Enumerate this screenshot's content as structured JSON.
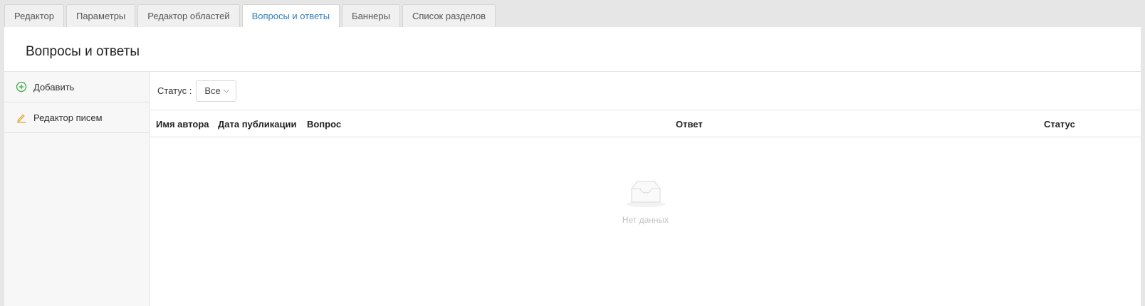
{
  "tabs": [
    {
      "label": "Редактор"
    },
    {
      "label": "Параметры"
    },
    {
      "label": "Редактор областей"
    },
    {
      "label": "Вопросы и ответы",
      "active": true
    },
    {
      "label": "Баннеры"
    },
    {
      "label": "Список разделов"
    }
  ],
  "page": {
    "title": "Вопросы и ответы"
  },
  "sidebar": {
    "items": [
      {
        "label": "Добавить",
        "icon": "plus-circle-icon",
        "color": "#3aa845"
      },
      {
        "label": "Редактор писем",
        "icon": "pencil-icon",
        "color": "#e0a020"
      }
    ]
  },
  "filter": {
    "label": "Статус :",
    "value": "Все"
  },
  "table": {
    "columns": [
      "Имя автора",
      "Дата публикации",
      "Вопрос",
      "Ответ",
      "Статус"
    ],
    "rows": [],
    "empty_text": "Нет данных",
    "empty_icon": "inbox-icon"
  },
  "colors": {
    "active_tab": "#2d7fc1"
  }
}
